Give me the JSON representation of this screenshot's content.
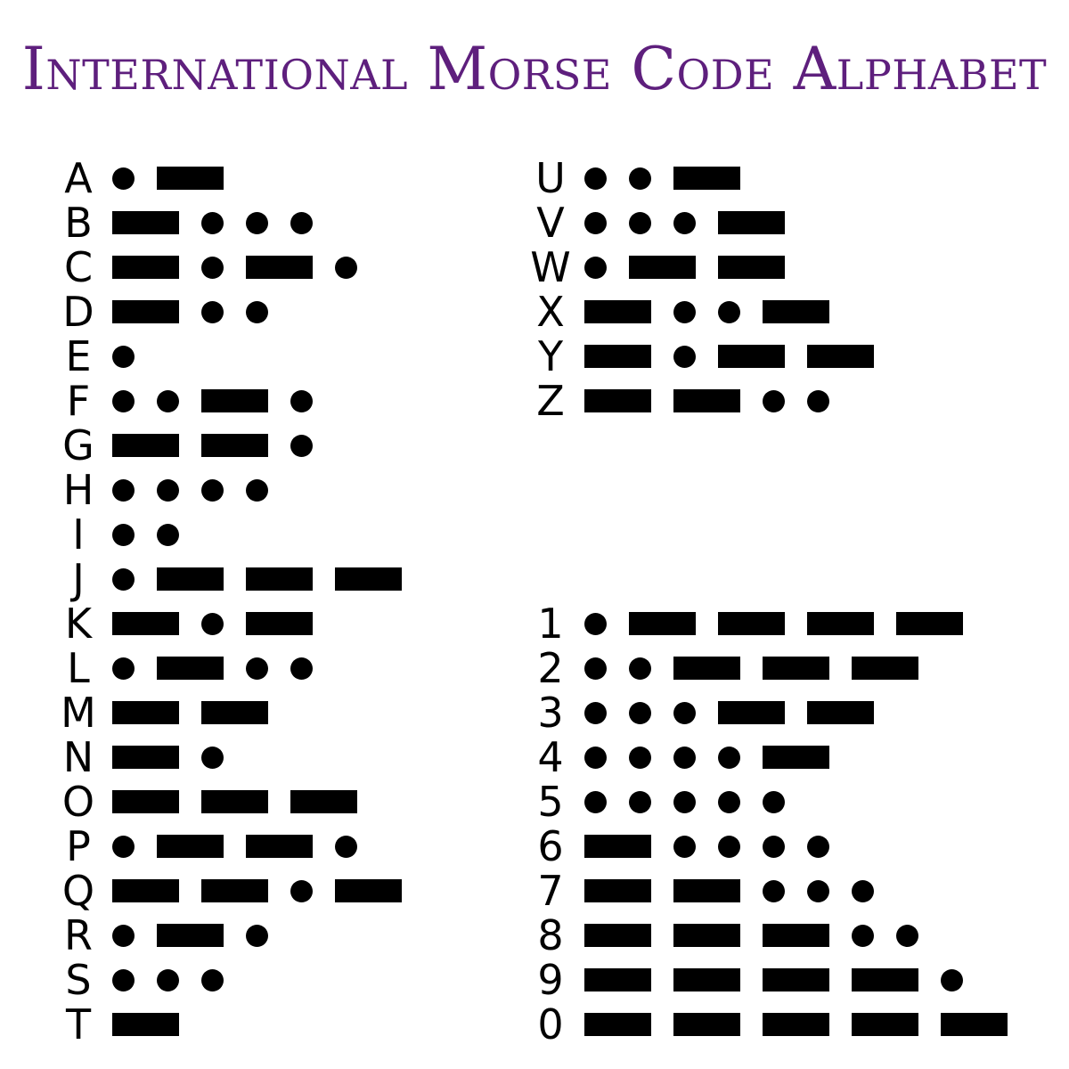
{
  "title": "International Morse Code Alphabet",
  "colors": {
    "title": "#5e1f7d",
    "symbols": "#000000",
    "background": "#ffffff"
  },
  "letters": [
    {
      "char": "A",
      "code": ".-"
    },
    {
      "char": "B",
      "code": "-..."
    },
    {
      "char": "C",
      "code": "-.-."
    },
    {
      "char": "D",
      "code": "-.."
    },
    {
      "char": "E",
      "code": "."
    },
    {
      "char": "F",
      "code": "..-."
    },
    {
      "char": "G",
      "code": "--."
    },
    {
      "char": "H",
      "code": "...."
    },
    {
      "char": "I",
      "code": ".."
    },
    {
      "char": "J",
      "code": ".---"
    },
    {
      "char": "K",
      "code": "-.-"
    },
    {
      "char": "L",
      "code": ".-.."
    },
    {
      "char": "M",
      "code": "--"
    },
    {
      "char": "N",
      "code": "-."
    },
    {
      "char": "O",
      "code": "---"
    },
    {
      "char": "P",
      "code": ".--."
    },
    {
      "char": "Q",
      "code": "--.-"
    },
    {
      "char": "R",
      "code": ".-."
    },
    {
      "char": "S",
      "code": "..."
    },
    {
      "char": "T",
      "code": "-"
    },
    {
      "char": "U",
      "code": "..-"
    },
    {
      "char": "V",
      "code": "...-"
    },
    {
      "char": "W",
      "code": ".--"
    },
    {
      "char": "X",
      "code": "-..-"
    },
    {
      "char": "Y",
      "code": "-.--"
    },
    {
      "char": "Z",
      "code": "--.."
    }
  ],
  "numbers": [
    {
      "char": "1",
      "code": ".----"
    },
    {
      "char": "2",
      "code": "..---"
    },
    {
      "char": "3",
      "code": "...--"
    },
    {
      "char": "4",
      "code": "....-"
    },
    {
      "char": "5",
      "code": "....."
    },
    {
      "char": "6",
      "code": "-...."
    },
    {
      "char": "7",
      "code": "--..."
    },
    {
      "char": "8",
      "code": "---.."
    },
    {
      "char": "9",
      "code": "----."
    },
    {
      "char": "0",
      "code": "-----"
    }
  ]
}
